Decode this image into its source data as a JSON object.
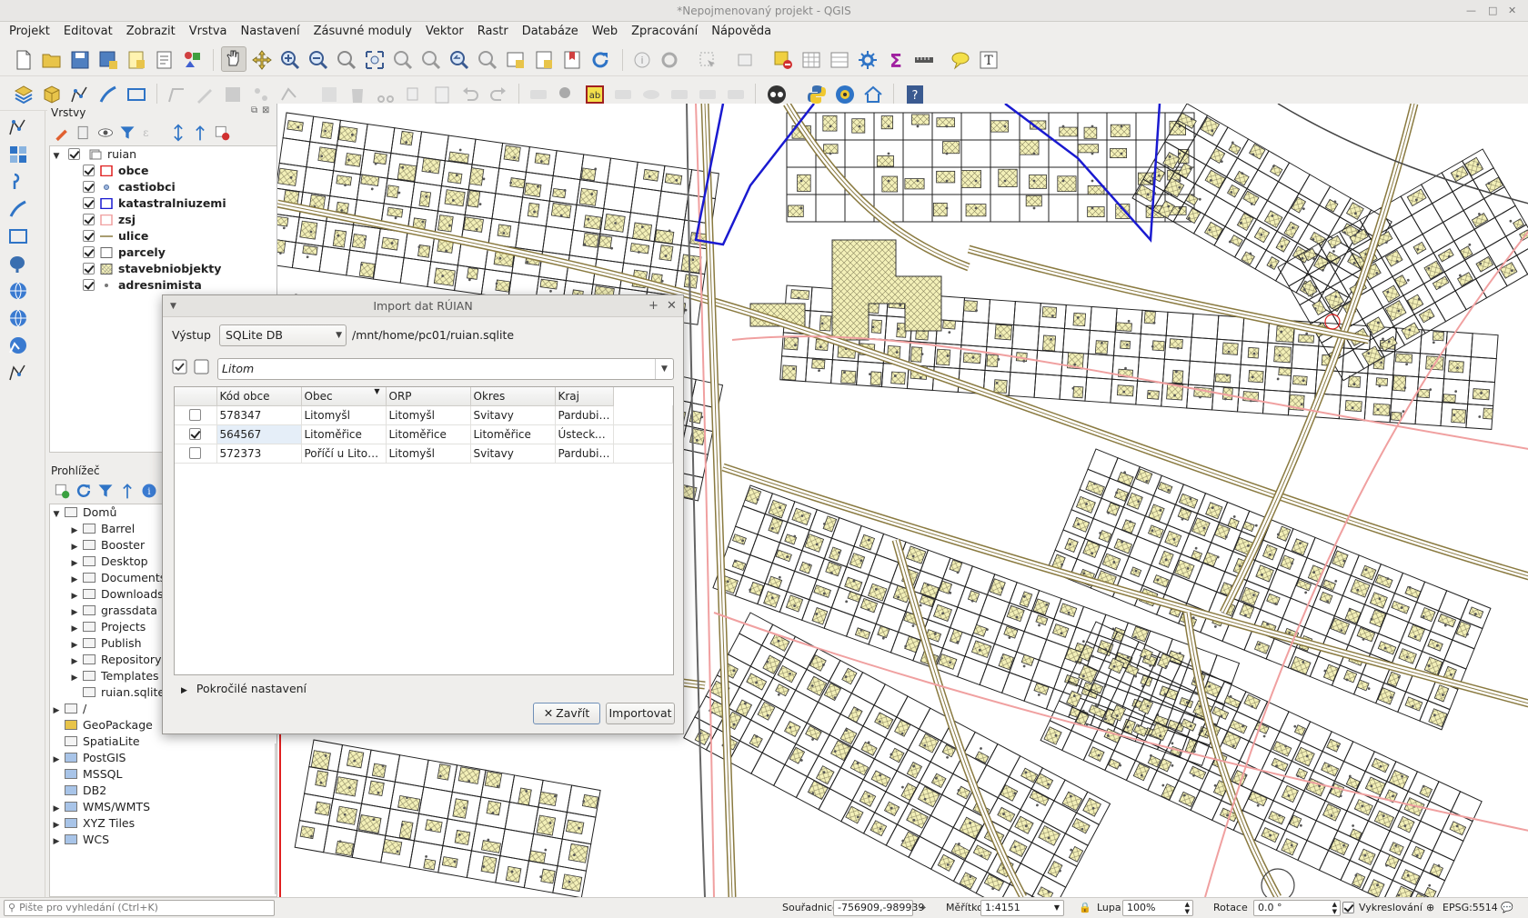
{
  "window": {
    "title": "*Nepojmenovaný projekt - QGIS"
  },
  "menu": [
    "Projekt",
    "Editovat",
    "Zobrazit",
    "Vrstva",
    "Nastavení",
    "Zásuvné moduly",
    "Vektor",
    "Rastr",
    "Databáze",
    "Web",
    "Zpracování",
    "Nápověda"
  ],
  "layers_panel": {
    "title": "Vrstvy",
    "group": "ruian",
    "layers": [
      {
        "name": "obce",
        "symbol": "outline-red"
      },
      {
        "name": "castiobci",
        "symbol": "point-blue"
      },
      {
        "name": "katastralniuzemi",
        "symbol": "outline-blue"
      },
      {
        "name": "zsj",
        "symbol": "outline-pink"
      },
      {
        "name": "ulice",
        "symbol": "line-olive"
      },
      {
        "name": "parcely",
        "symbol": "outline-gray"
      },
      {
        "name": "stavebniobjekty",
        "symbol": "hatch-yellow"
      },
      {
        "name": "adresnimista",
        "symbol": "point-gray"
      }
    ]
  },
  "browser_panel": {
    "title": "Prohlížeč",
    "home": "Domů",
    "home_items": [
      "Barrel",
      "Booster",
      "Desktop",
      "Documents",
      "Downloads",
      "grassdata",
      "Projects",
      "Publish",
      "Repository",
      "Templates",
      "ruian.sqlite"
    ],
    "root_items": [
      "/",
      "GeoPackage",
      "SpatiaLite",
      "PostGIS",
      "MSSQL",
      "DB2",
      "WMS/WMTS",
      "XYZ Tiles",
      "WCS"
    ]
  },
  "dialog": {
    "title": "Import dat RÚIAN",
    "output_label": "Výstup",
    "output_value": "SQLite DB",
    "output_path": "/mnt/home/pc01/ruian.sqlite",
    "filter_value": "Litom",
    "columns": [
      "Kód obce",
      "Obec",
      "ORP",
      "Okres",
      "Kraj"
    ],
    "rows": [
      {
        "checked": false,
        "cells": [
          "578347",
          "Litomyšl",
          "Litomyšl",
          "Svitavy",
          "Pardubický kraj"
        ]
      },
      {
        "checked": true,
        "cells": [
          "564567",
          "Litoměřice",
          "Litoměřice",
          "Litoměřice",
          "Ústecký kraj"
        ]
      },
      {
        "checked": false,
        "cells": [
          "572373",
          "Poříčí u Litom…",
          "Litomyšl",
          "Svitavy",
          "Pardubický kraj"
        ]
      }
    ],
    "advanced_label": "Pokročilé nastavení",
    "close_label": "Zavřít",
    "import_label": "Importovat"
  },
  "statusbar": {
    "search_placeholder": "Pište pro vyhledání (Ctrl+K)",
    "coord_label": "Souřadnice",
    "coord_value": "-756909,-989939",
    "scale_label": "Měřítko",
    "scale_value": "1:4151",
    "zoom_label": "Lupa",
    "zoom_value": "100%",
    "rotation_label": "Rotace",
    "rotation_value": "0.0 °",
    "render_label": "Vykreslování",
    "crs": "EPSG:5514"
  },
  "colors": {
    "obce": "#e02020",
    "katastr": "#1a1ad0",
    "zsj": "#f0a0a0",
    "ulice": "#8a7a40",
    "stavby": "#f3f0b8",
    "parcely": "#222222"
  }
}
